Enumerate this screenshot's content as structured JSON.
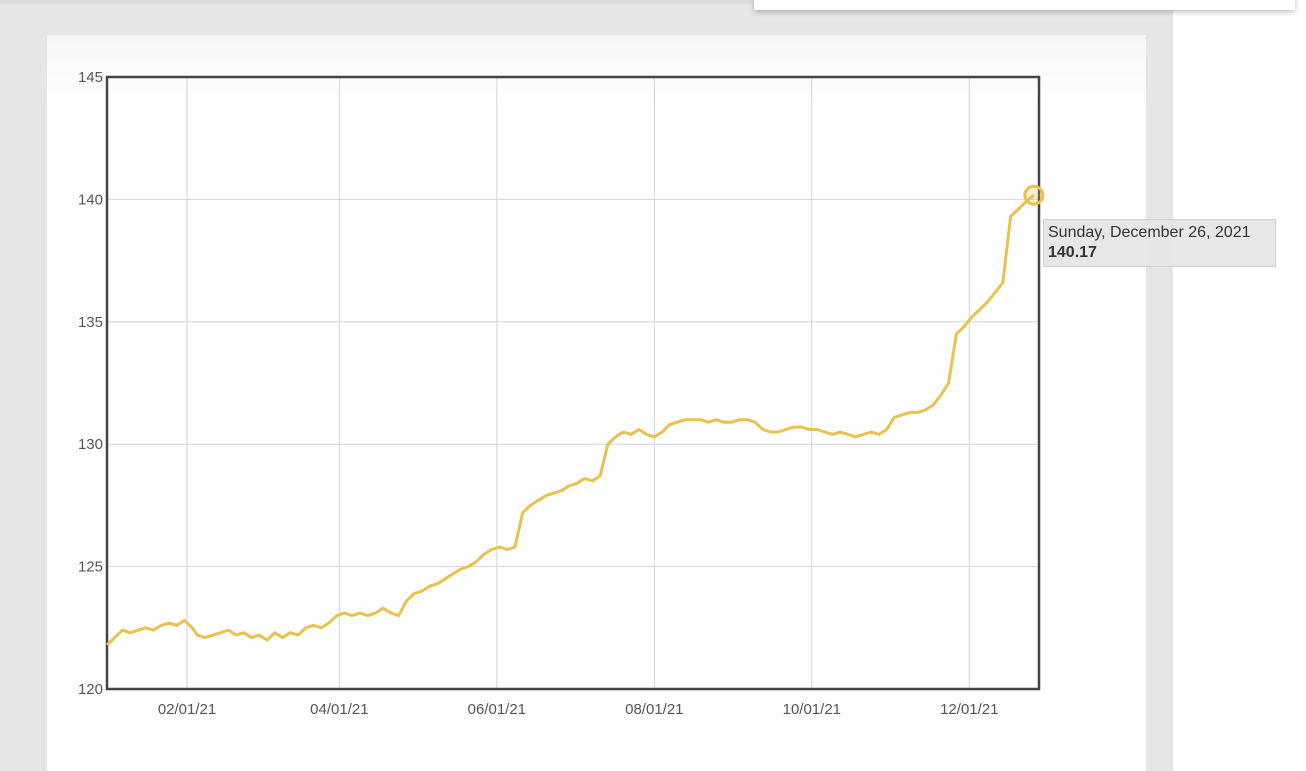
{
  "colors": {
    "line": "#e8c14e",
    "grid": "#d4d4d4",
    "axis": "#444444",
    "tick_text": "#555555"
  },
  "tooltip": {
    "date": "Sunday, December 26, 2021",
    "value": "140.17"
  },
  "chart_data": {
    "type": "line",
    "grid": true,
    "ylim": [
      120,
      145
    ],
    "xlim": [
      "2021-01-01",
      "2021-12-28"
    ],
    "yticks": [
      120,
      125,
      130,
      135,
      140,
      145
    ],
    "xticks": [
      {
        "date": "2021-02-01",
        "label": "02/01/21"
      },
      {
        "date": "2021-04-01",
        "label": "04/01/21"
      },
      {
        "date": "2021-06-01",
        "label": "06/01/21"
      },
      {
        "date": "2021-08-01",
        "label": "08/01/21"
      },
      {
        "date": "2021-10-01",
        "label": "10/01/21"
      },
      {
        "date": "2021-12-01",
        "label": "12/01/21"
      }
    ],
    "highlight": {
      "x": "2021-12-26",
      "y": 140.17
    },
    "series": [
      {
        "points": [
          [
            "2021-01-01",
            121.8
          ],
          [
            "2021-01-04",
            122.1
          ],
          [
            "2021-01-07",
            122.4
          ],
          [
            "2021-01-10",
            122.3
          ],
          [
            "2021-01-13",
            122.4
          ],
          [
            "2021-01-16",
            122.5
          ],
          [
            "2021-01-19",
            122.4
          ],
          [
            "2021-01-22",
            122.6
          ],
          [
            "2021-01-25",
            122.7
          ],
          [
            "2021-01-28",
            122.6
          ],
          [
            "2021-01-31",
            122.8
          ],
          [
            "2021-02-03",
            122.5
          ],
          [
            "2021-02-05",
            122.2
          ],
          [
            "2021-02-08",
            122.1
          ],
          [
            "2021-02-11",
            122.2
          ],
          [
            "2021-02-14",
            122.3
          ],
          [
            "2021-02-17",
            122.4
          ],
          [
            "2021-02-20",
            122.2
          ],
          [
            "2021-02-23",
            122.3
          ],
          [
            "2021-02-26",
            122.1
          ],
          [
            "2021-03-01",
            122.2
          ],
          [
            "2021-03-04",
            122.0
          ],
          [
            "2021-03-07",
            122.3
          ],
          [
            "2021-03-10",
            122.1
          ],
          [
            "2021-03-13",
            122.3
          ],
          [
            "2021-03-16",
            122.2
          ],
          [
            "2021-03-19",
            122.5
          ],
          [
            "2021-03-22",
            122.6
          ],
          [
            "2021-03-25",
            122.5
          ],
          [
            "2021-03-28",
            122.7
          ],
          [
            "2021-03-31",
            123.0
          ],
          [
            "2021-04-03",
            123.1
          ],
          [
            "2021-04-06",
            123.0
          ],
          [
            "2021-04-09",
            123.1
          ],
          [
            "2021-04-12",
            123.0
          ],
          [
            "2021-04-15",
            123.1
          ],
          [
            "2021-04-18",
            123.3
          ],
          [
            "2021-04-21",
            123.1
          ],
          [
            "2021-04-24",
            123.0
          ],
          [
            "2021-04-27",
            123.6
          ],
          [
            "2021-04-30",
            123.9
          ],
          [
            "2021-05-03",
            124.0
          ],
          [
            "2021-05-06",
            124.2
          ],
          [
            "2021-05-09",
            124.3
          ],
          [
            "2021-05-12",
            124.5
          ],
          [
            "2021-05-15",
            124.7
          ],
          [
            "2021-05-18",
            124.9
          ],
          [
            "2021-05-21",
            125.0
          ],
          [
            "2021-05-24",
            125.2
          ],
          [
            "2021-05-27",
            125.5
          ],
          [
            "2021-05-30",
            125.7
          ],
          [
            "2021-06-02",
            125.8
          ],
          [
            "2021-06-05",
            125.7
          ],
          [
            "2021-06-08",
            125.8
          ],
          [
            "2021-06-11",
            127.2
          ],
          [
            "2021-06-14",
            127.5
          ],
          [
            "2021-06-17",
            127.7
          ],
          [
            "2021-06-20",
            127.9
          ],
          [
            "2021-06-23",
            128.0
          ],
          [
            "2021-06-26",
            128.1
          ],
          [
            "2021-06-29",
            128.3
          ],
          [
            "2021-07-02",
            128.4
          ],
          [
            "2021-07-05",
            128.6
          ],
          [
            "2021-07-08",
            128.5
          ],
          [
            "2021-07-11",
            128.7
          ],
          [
            "2021-07-14",
            130.0
          ],
          [
            "2021-07-17",
            130.3
          ],
          [
            "2021-07-20",
            130.5
          ],
          [
            "2021-07-23",
            130.4
          ],
          [
            "2021-07-26",
            130.6
          ],
          [
            "2021-07-29",
            130.4
          ],
          [
            "2021-08-01",
            130.3
          ],
          [
            "2021-08-04",
            130.5
          ],
          [
            "2021-08-07",
            130.8
          ],
          [
            "2021-08-10",
            130.9
          ],
          [
            "2021-08-13",
            131.0
          ],
          [
            "2021-08-16",
            131.0
          ],
          [
            "2021-08-19",
            131.0
          ],
          [
            "2021-08-22",
            130.9
          ],
          [
            "2021-08-25",
            131.0
          ],
          [
            "2021-08-28",
            130.9
          ],
          [
            "2021-08-31",
            130.9
          ],
          [
            "2021-09-03",
            131.0
          ],
          [
            "2021-09-06",
            131.0
          ],
          [
            "2021-09-09",
            130.9
          ],
          [
            "2021-09-12",
            130.6
          ],
          [
            "2021-09-15",
            130.5
          ],
          [
            "2021-09-18",
            130.5
          ],
          [
            "2021-09-21",
            130.6
          ],
          [
            "2021-09-24",
            130.7
          ],
          [
            "2021-09-27",
            130.7
          ],
          [
            "2021-09-30",
            130.6
          ],
          [
            "2021-10-03",
            130.6
          ],
          [
            "2021-10-06",
            130.5
          ],
          [
            "2021-10-09",
            130.4
          ],
          [
            "2021-10-12",
            130.5
          ],
          [
            "2021-10-15",
            130.4
          ],
          [
            "2021-10-18",
            130.3
          ],
          [
            "2021-10-21",
            130.4
          ],
          [
            "2021-10-24",
            130.5
          ],
          [
            "2021-10-27",
            130.4
          ],
          [
            "2021-10-30",
            130.6
          ],
          [
            "2021-11-02",
            131.1
          ],
          [
            "2021-11-05",
            131.2
          ],
          [
            "2021-11-08",
            131.3
          ],
          [
            "2021-11-11",
            131.3
          ],
          [
            "2021-11-14",
            131.4
          ],
          [
            "2021-11-17",
            131.6
          ],
          [
            "2021-11-20",
            132.0
          ],
          [
            "2021-11-23",
            132.5
          ],
          [
            "2021-11-26",
            134.5
          ],
          [
            "2021-11-29",
            134.8
          ],
          [
            "2021-12-02",
            135.2
          ],
          [
            "2021-12-05",
            135.5
          ],
          [
            "2021-12-08",
            135.8
          ],
          [
            "2021-12-11",
            136.2
          ],
          [
            "2021-12-14",
            136.6
          ],
          [
            "2021-12-17",
            139.3
          ],
          [
            "2021-12-20",
            139.6
          ],
          [
            "2021-12-23",
            139.9
          ],
          [
            "2021-12-26",
            140.17
          ]
        ]
      }
    ]
  }
}
